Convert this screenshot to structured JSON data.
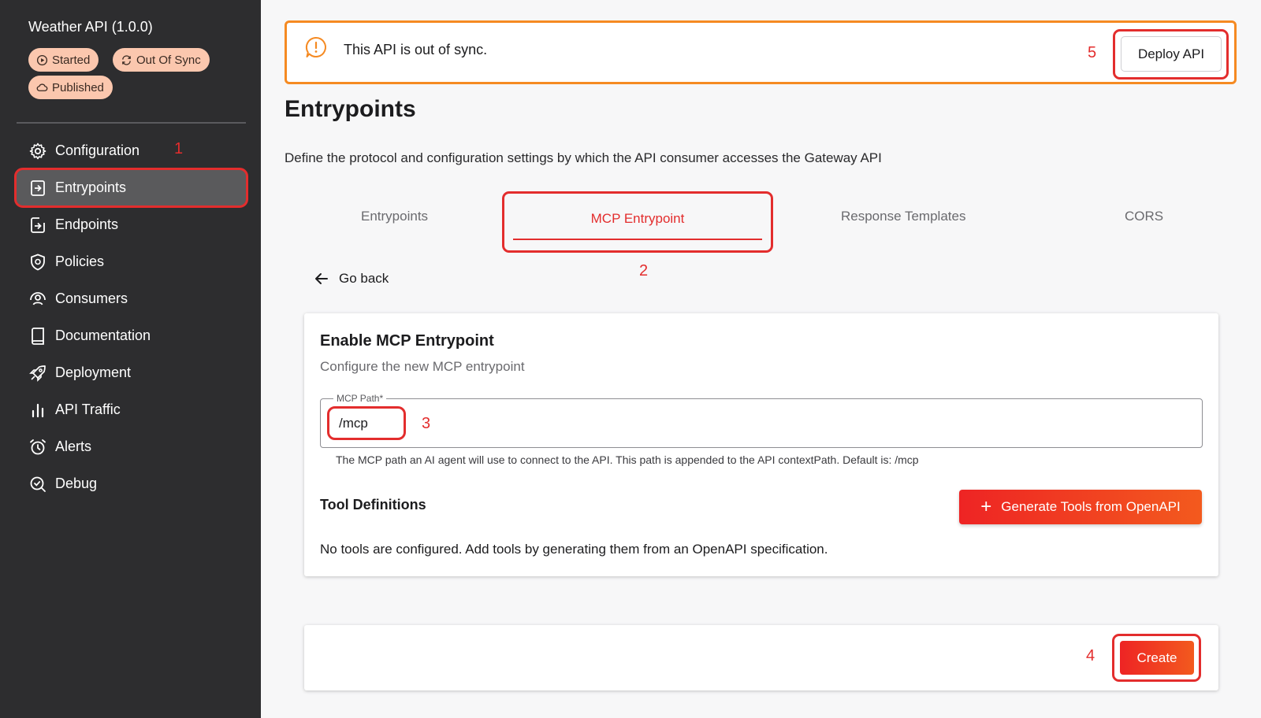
{
  "sidebar": {
    "api_title": "Weather API (1.0.0)",
    "badges": {
      "started": "Started",
      "out_of_sync": "Out Of Sync",
      "published": "Published"
    },
    "items": [
      {
        "label": "Configuration",
        "icon": "gear-icon"
      },
      {
        "label": "Entrypoints",
        "icon": "entrypoint-icon",
        "active": true
      },
      {
        "label": "Endpoints",
        "icon": "endpoint-icon"
      },
      {
        "label": "Policies",
        "icon": "shield-icon"
      },
      {
        "label": "Consumers",
        "icon": "consumers-icon"
      },
      {
        "label": "Documentation",
        "icon": "book-icon"
      },
      {
        "label": "Deployment",
        "icon": "rocket-icon"
      },
      {
        "label": "API Traffic",
        "icon": "bar-chart-icon"
      },
      {
        "label": "Alerts",
        "icon": "alarm-icon"
      },
      {
        "label": "Debug",
        "icon": "debug-icon"
      }
    ]
  },
  "annotations": {
    "m1": "1",
    "m2": "2",
    "m3": "3",
    "m4": "4",
    "m5": "5"
  },
  "banner": {
    "message": "This API is out of sync.",
    "deploy_label": "Deploy API"
  },
  "header": {
    "title": "Entrypoints",
    "description": "Define the protocol and configuration settings by which the API consumer accesses the Gateway API"
  },
  "tabs": [
    {
      "label": "Entrypoints"
    },
    {
      "label": "MCP Entrypoint",
      "active": true
    },
    {
      "label": "Response Templates"
    },
    {
      "label": "CORS"
    }
  ],
  "go_back": "Go back",
  "card": {
    "title": "Enable MCP Entrypoint",
    "subtitle": "Configure the new MCP entrypoint",
    "field_label": "MCP Path*",
    "field_value": "/mcp",
    "help_text": "The MCP path an AI agent will use to connect to the API. This path is appended to the API contextPath. Default is: /mcp",
    "tool_defs_title": "Tool Definitions",
    "generate_label": "Generate Tools from OpenAPI",
    "empty_message": "No tools are configured. Add tools by generating them from an OpenAPI specification."
  },
  "footer": {
    "create_label": "Create"
  },
  "colors": {
    "sidebar_bg": "#2d2d2f",
    "accent_red": "#e32d2d",
    "banner_border": "#f58a22",
    "badge_bg": "#fbc7ae"
  }
}
